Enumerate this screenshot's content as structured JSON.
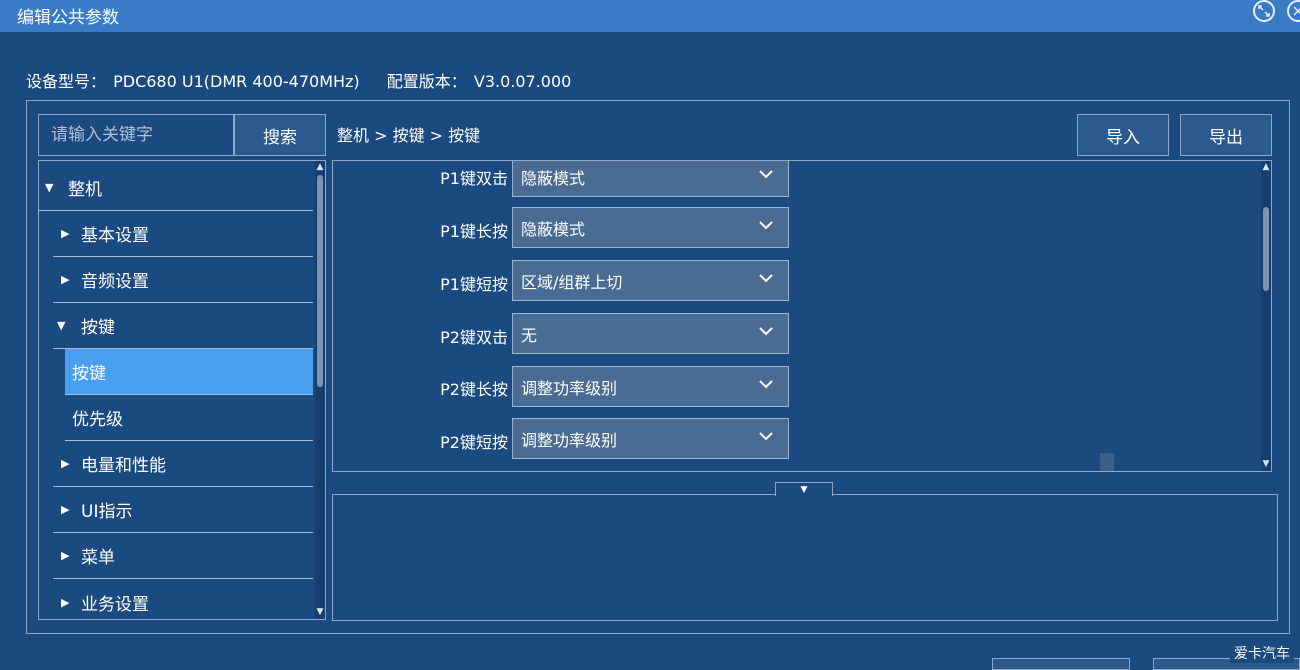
{
  "window": {
    "title": "编辑公共参数",
    "maximize_icon": "expand-icon",
    "close_icon": "close-icon"
  },
  "device": {
    "model_label": "设备型号：",
    "model_value": "PDC680 U1(DMR 400-470MHz)",
    "version_label": "配置版本：",
    "version_value": "V3.0.07.000"
  },
  "search": {
    "placeholder": "请输入关键字",
    "button_label": "搜索"
  },
  "breadcrumb": "整机 > 按键 > 按键",
  "toolbar": {
    "import_label": "导入",
    "export_label": "导出"
  },
  "tree": {
    "items": [
      {
        "label": "整机",
        "caret": "▼",
        "level": 0
      },
      {
        "label": "基本设置",
        "caret": "▶",
        "level": 1
      },
      {
        "label": "音频设置",
        "caret": "▶",
        "level": 1
      },
      {
        "label": "按键",
        "caret": "▼",
        "level": 1
      },
      {
        "label": "按键",
        "caret": "",
        "level": 2,
        "selected": true
      },
      {
        "label": "优先级",
        "caret": "",
        "level": 2
      },
      {
        "label": "电量和性能",
        "caret": "▶",
        "level": 1
      },
      {
        "label": "UI指示",
        "caret": "▶",
        "level": 1
      },
      {
        "label": "菜单",
        "caret": "▶",
        "level": 1
      },
      {
        "label": "业务设置",
        "caret": "▶",
        "level": 1
      }
    ]
  },
  "params": [
    {
      "label": "P1键双击",
      "value": "隐蔽模式"
    },
    {
      "label": "P1键长按",
      "value": "隐蔽模式"
    },
    {
      "label": "P1键短按",
      "value": "区域/组群上切"
    },
    {
      "label": "P2键双击",
      "value": "无"
    },
    {
      "label": "P2键长按",
      "value": "调整功率级别"
    },
    {
      "label": "P2键短按",
      "value": "调整功率级别"
    }
  ],
  "watermark": "爱卡汽车",
  "colors": {
    "background": "#1b4a80",
    "titlebar": "#3a7bc8",
    "selected": "#4a9ef0",
    "select_bg": "#4b6c92"
  }
}
